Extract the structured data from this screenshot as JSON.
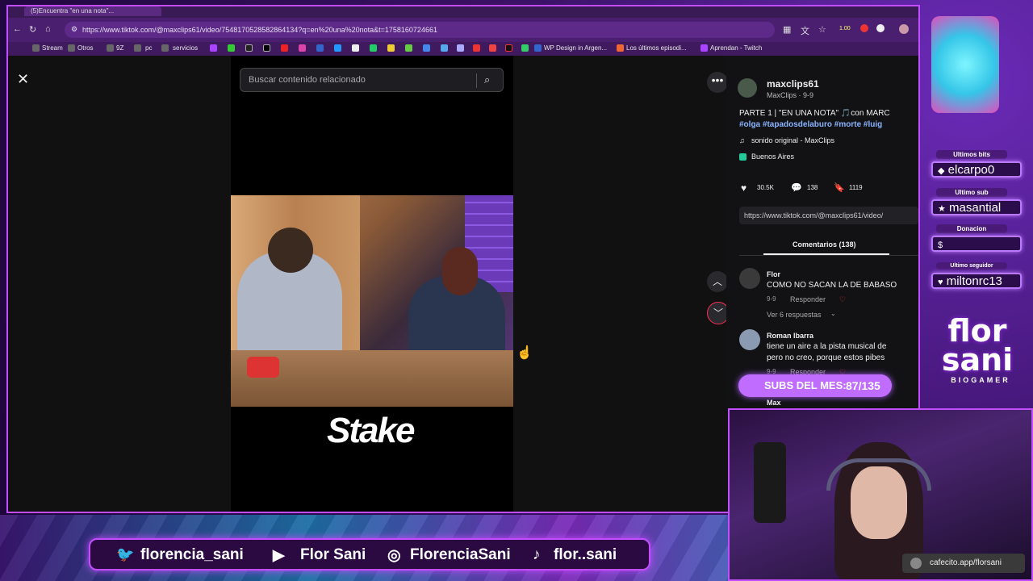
{
  "browser": {
    "tab_title": "(5)Encuentra \"en una nota\"...",
    "url": "https://www.tiktok.com/@maxclips61/video/7548170528582864134?q=en%20una%20nota&t=1758160724661",
    "zoom": "1.00",
    "bookmarks": [
      "Stream",
      "Otros",
      "9Z",
      "pc",
      "servicios",
      "WP Design in Argen...",
      "Los últimos episodi...",
      "Aprendan - Twitch"
    ]
  },
  "tiktok": {
    "search_placeholder": "Buscar contenido relacionado",
    "video_brand": "Stake",
    "author": {
      "username": "maxclips61",
      "meta": "MaxClips · 9-9"
    },
    "caption": "PARTE 1 | \"EN UNA NOTA\" 🎵con MARC",
    "hashtags": "#olga #tapadosdelaburo #morte #luig",
    "sound": "sonido original - MaxClips",
    "location": "Buenos Aires",
    "likes": "30.5K",
    "comments_count": "138",
    "saves": "1119",
    "share_url": "https://www.tiktok.com/@maxclips61/video/",
    "comments_tab": "Comentarios (138)",
    "comments": [
      {
        "user": "Flor",
        "text": "COMO NO SACAN LA DE BABASO",
        "date": "9-9",
        "reply": "Responder",
        "more": "Ver 6 respuestas"
      },
      {
        "user": "Roman Ibarra",
        "text": "tiene un aire a la pista musical de",
        "text2": "pero no creo, porque estos pibes",
        "date": "9-9",
        "reply": "Responder"
      },
      {
        "user": "Max",
        "text": ""
      }
    ]
  },
  "overlay": {
    "last_bits_label": "Ultimos bits",
    "last_bits_user": "elcarpo0",
    "last_sub_label": "Ultimo sub",
    "last_sub_user": "masantial",
    "donation_label": "Donacion",
    "donation_user": "",
    "follower_label": "Ultimo seguidor",
    "follower_user": "miltonrc13",
    "logo_line1": "flor",
    "logo_line2": "sani",
    "logo_tag": "BIOGAMER",
    "subs_label": "SUBS DEL MES:",
    "subs_value": "87/135",
    "socials": [
      "florencia_sani",
      "Flor Sani",
      "FlorenciaSani",
      "flor..sani"
    ],
    "cafecito": "cafecito.app/florsani"
  }
}
